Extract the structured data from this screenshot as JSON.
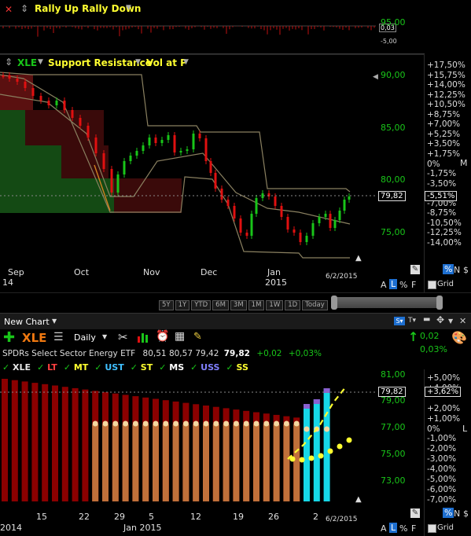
{
  "top_panel": {
    "title": "Rally Up Rally Down",
    "value_box": "0,03",
    "axis_value": "-5,00"
  },
  "main_panel": {
    "symbol": "XLE",
    "indicator": "Support Resistance",
    "vol_at_price": "Vol at P",
    "right_axis_pct": [
      "+17,50%",
      "+15,75%",
      "+14,00%",
      "+12,25%",
      "+10,50%",
      "+8,75%",
      "+7,00%",
      "+5,25%",
      "+3,50%",
      "+1,75%",
      "0%",
      "-1,75%",
      "-3,50%",
      "-5,51%",
      "-7,00%",
      "-8,75%",
      "-10,50%",
      "-12,25%",
      "-14,00%"
    ],
    "price_axis": [
      "95,00",
      "90,00",
      "85,00",
      "80,00",
      "75,00"
    ],
    "price_tag": "79,82",
    "pct_tag": "-5,51%",
    "pct_M": "M",
    "x_labels": [
      "Sep",
      "Oct",
      "Nov",
      "Dec",
      "Jan"
    ],
    "year_labels": [
      "14",
      "2015"
    ],
    "date": "6/2/2015",
    "mode_A": "A",
    "mode_L": "L",
    "mode_pct": "%",
    "mode_F": "F",
    "grid": "Grid",
    "right_pct": "%",
    "right_N": "N",
    "right_dollar": "$"
  },
  "timeframes": [
    "5Y",
    "1Y",
    "YTD",
    "6M",
    "3M",
    "1M",
    "1W",
    "1D",
    "Today"
  ],
  "new_chart": {
    "title": "New Chart",
    "symbol": "XLE",
    "period": "Daily",
    "change": "0,02",
    "change_pct": "0,03%",
    "description": "SPDRs Select Sector Energy ETF",
    "ohlc": "80,51  80,57  79,42",
    "last": "79,82",
    "chg": "+0,02",
    "chg_pct": "+0,03%",
    "indicators": [
      "XLE",
      "LT",
      "MT",
      "UST",
      "ST",
      "MS",
      "USS",
      "SS"
    ],
    "indicator_colors": [
      "#e8e8e8",
      "#ff4040",
      "#ffff30",
      "#40c0ff",
      "#ffff30",
      "#ffffff",
      "#8080ff",
      "#ffff30"
    ]
  },
  "lower_panel": {
    "price_axis": [
      "81,00",
      "79,00",
      "77,00",
      "75,00",
      "73,00"
    ],
    "pct_axis": [
      "+5,00%",
      "+4,00%",
      "+3,62%",
      "+2,00%",
      "+1,00%",
      "0%",
      "-1,00%",
      "-2,00%",
      "-3,00%",
      "-4,00%",
      "-5,00%",
      "-6,00%",
      "-7,00%"
    ],
    "price_tag": "79,82",
    "pct_tag": "+3,62%",
    "L_marker": "L",
    "x_labels": [
      "2014",
      "15",
      "22",
      "29",
      "5",
      "12",
      "19",
      "26",
      "2"
    ],
    "year_label": "Jan 2015",
    "date": "6/2/2015",
    "mode_A": "A",
    "mode_L": "L",
    "mode_pct": "%",
    "mode_F": "F",
    "grid": "Grid",
    "right_pct": "%",
    "right_N": "N",
    "right_dollar": "$"
  },
  "colors": {
    "up": "#19c519",
    "down": "#e01010",
    "band": "#8a8060",
    "darkred": "#8b0000",
    "brown": "#c0703a",
    "cyan": "#16d8e8",
    "accent": "#1e6fd0"
  }
}
